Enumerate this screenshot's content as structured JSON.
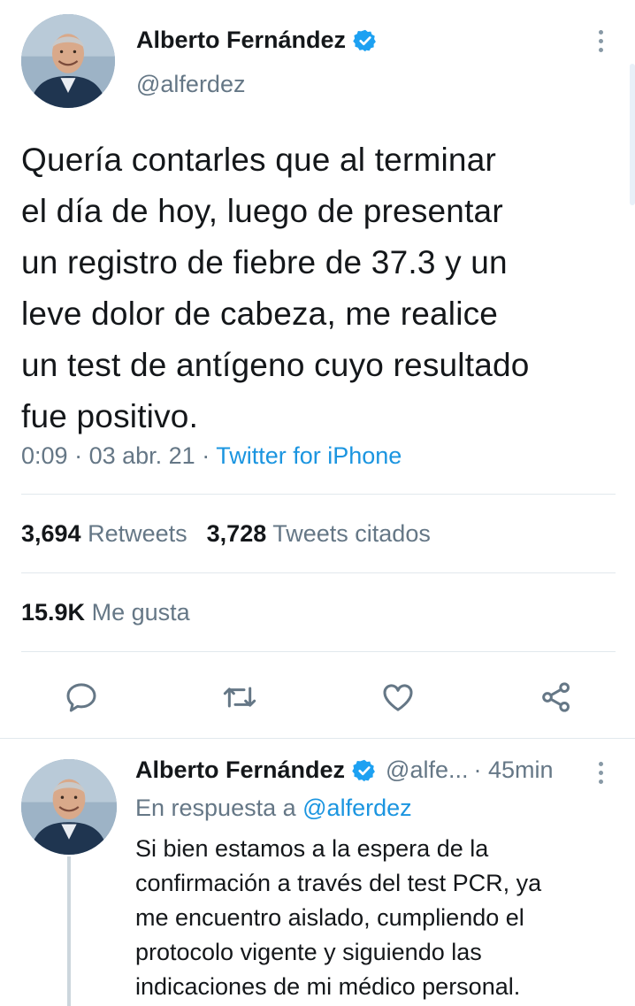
{
  "tweet": {
    "author_name": "Alberto Fernández",
    "handle": "@alferdez",
    "text": "Quería contarles que al terminar\nel día de hoy, luego de presentar\nun registro de fiebre de 37.3 y un\nleve dolor de cabeza, me realice\nun test de antígeno cuyo resultado\nfue positivo.",
    "time": "0:09",
    "date": "03 abr. 21",
    "source": "Twitter for iPhone",
    "retweets_count": "3,694",
    "retweets_label": "Retweets",
    "quotes_count": "3,728",
    "quotes_label": "Tweets citados",
    "likes_count": "15.9K",
    "likes_label": "Me gusta"
  },
  "icons": {
    "verified": "verified-badge-icon",
    "more": "more-vertical-icon",
    "reply": "reply-icon",
    "retweet": "retweet-icon",
    "like": "heart-icon",
    "share": "share-icon"
  },
  "reply": {
    "author_name": "Alberto Fernández",
    "handle": "@alfe...",
    "time": "45min",
    "in_reply_prefix": "En respuesta a",
    "in_reply_mention": "@alferdez",
    "text": "Si bien estamos a la espera de la\nconfirmación a través del test PCR, ya\nme encuentro aislado, cumpliendo el\nprotocolo vigente y siguiendo las\nindicaciones de mi médico personal."
  },
  "colors": {
    "accent": "#1b95e0",
    "verified": "#1da1f2",
    "secondary_text": "#657786",
    "primary_text": "#14171a",
    "divider": "#e1e8ed"
  }
}
